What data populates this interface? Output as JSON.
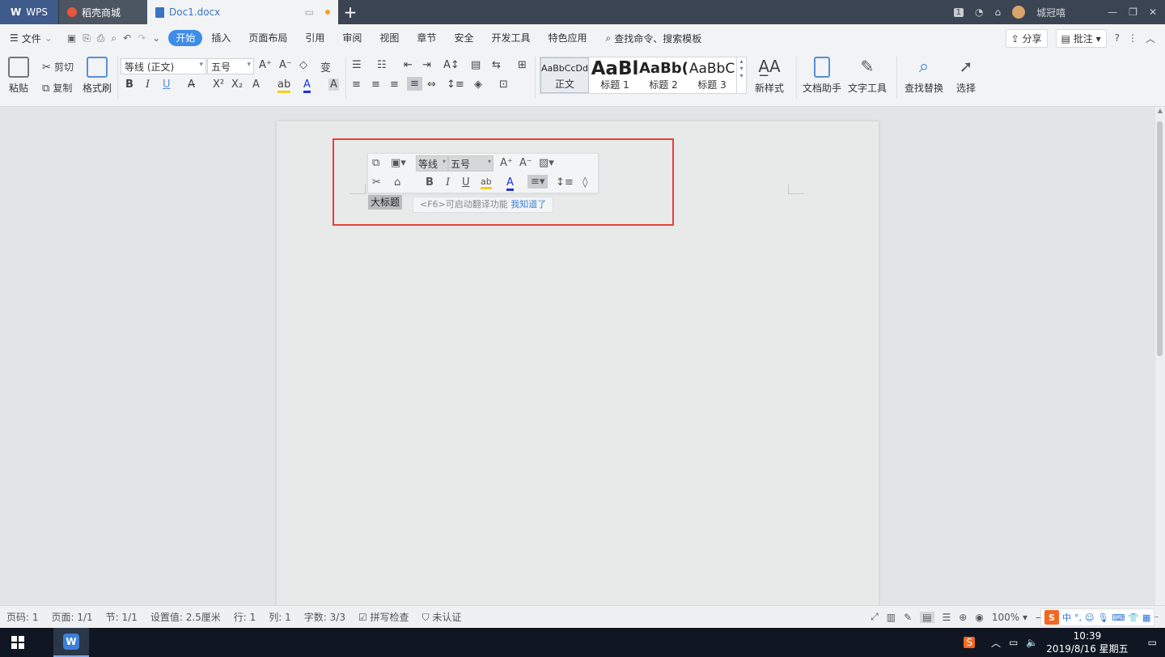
{
  "titlebar": {
    "tabs": [
      {
        "label": "WPS"
      },
      {
        "label": "稻壳商城"
      },
      {
        "label": "Doc1.docx"
      }
    ],
    "badge": "1",
    "user": "城冠嘻"
  },
  "menubar": {
    "file": "文件",
    "items": [
      "开始",
      "插入",
      "页面布局",
      "引用",
      "审阅",
      "视图",
      "章节",
      "安全",
      "开发工具",
      "特色应用"
    ],
    "search": "查找命令、搜索模板",
    "share": "分享",
    "comment": "批注"
  },
  "ribbon": {
    "paste": "粘贴",
    "cut": "剪切",
    "copy": "复制",
    "format_painter": "格式刷",
    "font": "等线 (正文)",
    "size": "五号",
    "bold": "B",
    "italic": "I",
    "underline": "U",
    "font_color": "A",
    "styles": [
      {
        "preview": "AaBbCcDd",
        "label": "正文"
      },
      {
        "preview": "AaBl",
        "label": "标题 1"
      },
      {
        "preview": "AaBb(",
        "label": "标题 2"
      },
      {
        "preview": "AaBbC",
        "label": "标题 3"
      }
    ],
    "new_style": "新样式",
    "doc_assistant": "文档助手",
    "text_tools": "文字工具",
    "find_replace": "查找替换",
    "select": "选择"
  },
  "mini_toolbar": {
    "font": "等线",
    "size": "五号",
    "bold": "B",
    "italic": "I",
    "underline": "U",
    "font_color": "A"
  },
  "document": {
    "selected_text": "大标题",
    "tip_text": "<F6>可启动翻译功能",
    "tip_link": "我知道了"
  },
  "statusbar": {
    "page": "页码: 1",
    "pages": "页面: 1/1",
    "section": "节: 1/1",
    "setting": "设置值: 2.5厘米",
    "row": "行: 1",
    "col": "列: 1",
    "words": "字数: 3/3",
    "spell": "拼写检查",
    "auth": "未认证",
    "zoom": "100%"
  },
  "ime": {
    "items": [
      "中",
      "°,"
    ]
  },
  "taskbar": {
    "time": "10:39",
    "date": "2019/8/16 星期五"
  },
  "colors": {
    "accent": "#3d8ce8",
    "highlight_box": "#e8403a",
    "titlebar": "#3a4452"
  }
}
